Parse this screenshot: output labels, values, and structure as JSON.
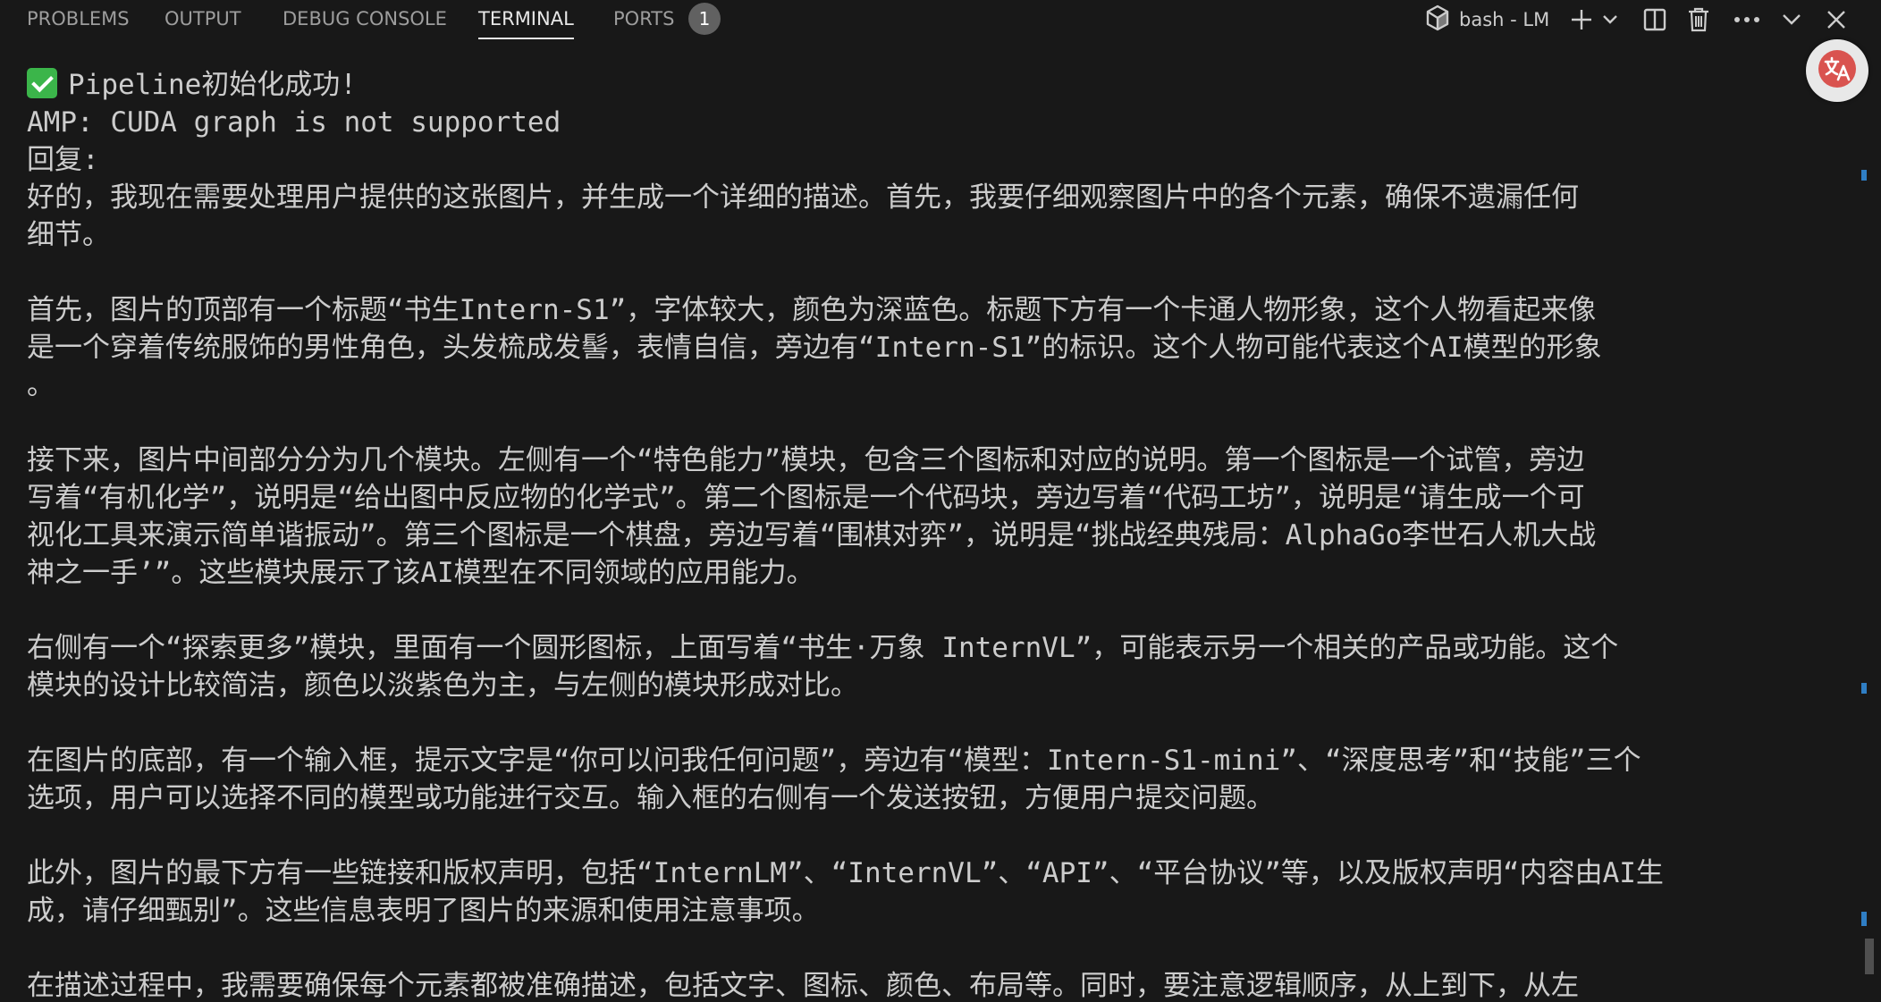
{
  "tabs": [
    {
      "label": "PROBLEMS"
    },
    {
      "label": "OUTPUT"
    },
    {
      "label": "DEBUG CONSOLE"
    },
    {
      "label": "TERMINAL",
      "active": true
    },
    {
      "label": "PORTS"
    }
  ],
  "ports_badge": "1",
  "terminal_name": "bash - LM",
  "icons": {
    "terminal": "terminal-cube-icon",
    "new_terminal": "plus-icon",
    "dropdown": "chevron-down-icon",
    "split": "split-icon",
    "kill": "trash-icon",
    "more": "ellipsis-icon",
    "maximize": "chevron-down-icon",
    "close": "close-icon",
    "translate": "translate-icon"
  },
  "colors": {
    "accent_blue": "#2f7ec4",
    "check_green": "#3bb54a",
    "translate_red": "#d9534f"
  },
  "terminal": {
    "lines": [
      "Pipeline初始化成功!",
      "AMP: CUDA graph is not supported",
      "回复:",
      "好的，我现在需要处理用户提供的这张图片，并生成一个详细的描述。首先，我要仔细观察图片中的各个元素，确保不遗漏任何",
      "细节。",
      "",
      "首先，图片的顶部有一个标题“书生Intern-S1”，字体较大，颜色为深蓝色。标题下方有一个卡通人物形象，这个人物看起来像",
      "是一个穿着传统服饰的男性角色，头发梳成发髻，表情自信，旁边有“Intern-S1”的标识。这个人物可能代表这个AI模型的形象",
      "。",
      "",
      "接下来，图片中间部分分为几个模块。左侧有一个“特色能力”模块，包含三个图标和对应的说明。第一个图标是一个试管，旁边",
      "写着“有机化学”，说明是“给出图中反应物的化学式”。第二个图标是一个代码块，旁边写着“代码工坊”，说明是“请生成一个可",
      "视化工具来演示简单谐振动”。第三个图标是一个棋盘，旁边写着“围棋对弈”，说明是“挑战经典残局：AlphaGo李世石人机大战",
      "神之一手’”。这些模块展示了该AI模型在不同领域的应用能力。",
      "",
      "右侧有一个“探索更多”模块，里面有一个圆形图标，上面写着“书生·万象 InternVL”，可能表示另一个相关的产品或功能。这个",
      "模块的设计比较简洁，颜色以淡紫色为主，与左侧的模块形成对比。",
      "",
      "在图片的底部，有一个输入框，提示文字是“你可以问我任何问题”，旁边有“模型：Intern-S1-mini”、“深度思考”和“技能”三个",
      "选项，用户可以选择不同的模型或功能进行交互。输入框的右侧有一个发送按钮，方便用户提交问题。",
      "",
      "此外，图片的最下方有一些链接和版权声明，包括“InternLM”、“InternVL”、“API”、“平台协议”等，以及版权声明“内容由AI生",
      "成，请仔细甄别”。这些信息表明了图片的来源和使用注意事项。",
      "",
      "在描述过程中，我需要确保每个元素都被准确描述，包括文字、图标、颜色、布局等。同时，要注意逻辑顺序，从上到下，从左"
    ]
  }
}
